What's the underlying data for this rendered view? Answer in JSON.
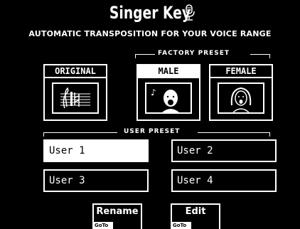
{
  "header": {
    "title": "Singer Key",
    "subtitle": "AUTOMATIC TRANSPOSITION FOR YOUR VOICE RANGE"
  },
  "factory_preset": {
    "group_label": "FACTORY PRESET",
    "original_label": "ORIGINAL",
    "male_label": "MALE",
    "female_label": "FEMALE",
    "selected": "MALE"
  },
  "user_preset": {
    "group_label": "USER PRESET",
    "slots": [
      "User 1",
      "User 2",
      "User 3",
      "User 4"
    ],
    "selected": "User 1"
  },
  "buttons": {
    "rename_label": "Rename",
    "edit_label": "Edit",
    "goto_label": "GoTo"
  },
  "icons": {
    "title_icon": "microphone-icon",
    "original_icon": "sheet-music-icon",
    "male_icon": "male-singer-icon",
    "female_icon": "female-singer-icon"
  }
}
